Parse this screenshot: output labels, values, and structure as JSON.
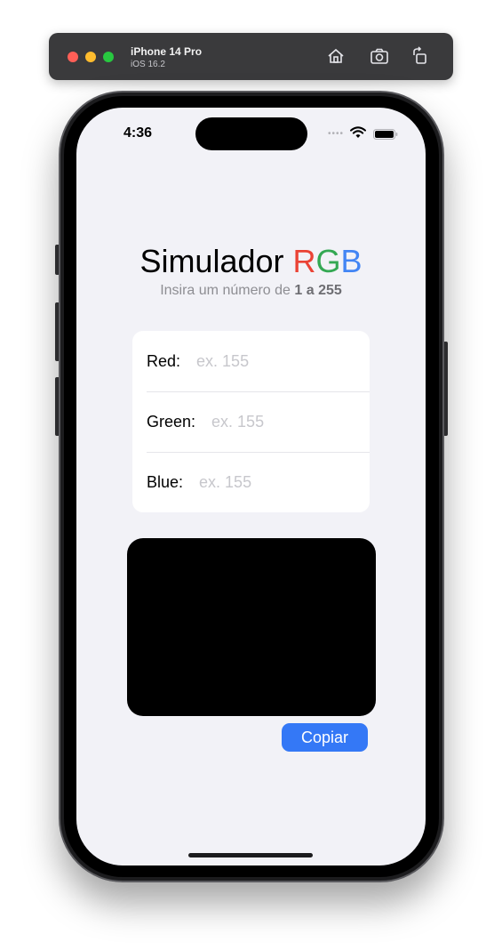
{
  "simulator": {
    "device_name": "iPhone 14 Pro",
    "os_version": "iOS 16.2",
    "icons": [
      "home-icon",
      "screenshot-icon",
      "rotate-icon"
    ]
  },
  "status_bar": {
    "time": "4:36",
    "icons": [
      "wifi-icon",
      "battery-icon"
    ]
  },
  "app": {
    "title_prefix": "Simulador ",
    "title_r": "R",
    "title_g": "G",
    "title_b": "B",
    "subtitle_prefix": "Insira um número de ",
    "subtitle_range": "1 a 255",
    "fields": [
      {
        "label": "Red:",
        "value": "",
        "placeholder": "ex. 155"
      },
      {
        "label": "Green:",
        "value": "",
        "placeholder": "ex. 155"
      },
      {
        "label": "Blue:",
        "value": "",
        "placeholder": "ex. 155"
      }
    ],
    "preview_color": "#000000",
    "copy_label": "Copiar"
  },
  "colors": {
    "red": "#ea4335",
    "green": "#34a853",
    "blue": "#4285f4",
    "accent": "#3478f6",
    "background": "#f2f2f7"
  }
}
